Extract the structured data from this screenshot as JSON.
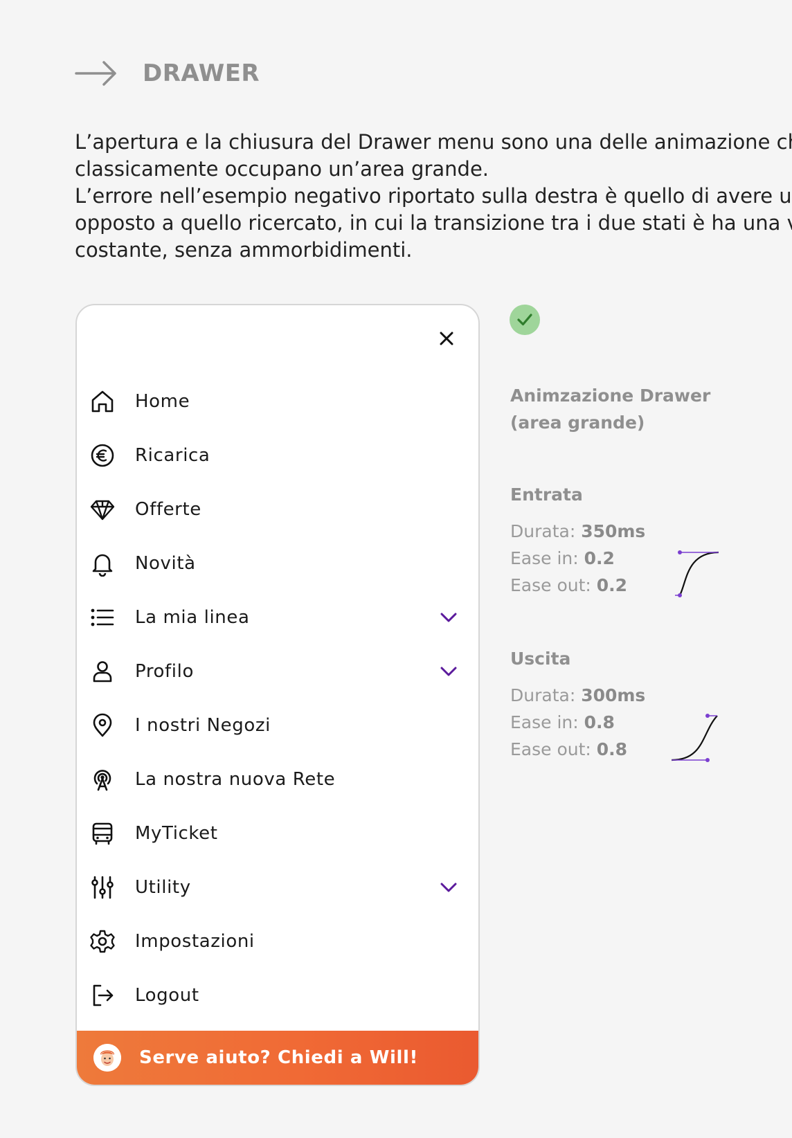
{
  "header": {
    "title": "DRAWER",
    "arrow_icon": "arrow-right-icon"
  },
  "intro": {
    "lines": [
      "L’apertura e la chiusura del Drawer menu sono una delle animazione ch",
      "classicamente occupano un’area grande.",
      "L’errore nell’esempio negativo riportato sulla destra è quello di avere un",
      "opposto a quello ricercato, in cui la transizione tra i due stati è ha una ve",
      "costante, senza ammorbidimenti."
    ]
  },
  "drawer": {
    "close_icon": "close-icon",
    "items": [
      {
        "label": "Home",
        "icon": "home-icon",
        "expandable": false
      },
      {
        "label": "Ricarica",
        "icon": "euro-icon",
        "expandable": false
      },
      {
        "label": "Offerte",
        "icon": "diamond-icon",
        "expandable": false
      },
      {
        "label": "Novità",
        "icon": "bell-icon",
        "expandable": false
      },
      {
        "label": "La mia linea",
        "icon": "list-icon",
        "expandable": true
      },
      {
        "label": "Profilo",
        "icon": "user-icon",
        "expandable": true
      },
      {
        "label": "I nostri Negozi",
        "icon": "location-pin-icon",
        "expandable": false
      },
      {
        "label": "La nostra nuova Rete",
        "icon": "antenna-icon",
        "expandable": false
      },
      {
        "label": "MyTicket",
        "icon": "bus-icon",
        "expandable": false
      },
      {
        "label": "Utility",
        "icon": "sliders-icon",
        "expandable": true
      },
      {
        "label": "Impostazioni",
        "icon": "gear-icon",
        "expandable": false
      },
      {
        "label": "Logout",
        "icon": "logout-icon",
        "expandable": false
      }
    ],
    "help": {
      "label": "Serve aiuto? Chiedi a Will!",
      "avatar_icon": "will-avatar-icon"
    },
    "accent_color": "#5b1a9c",
    "help_color": "#ee6a35"
  },
  "panel": {
    "status_icon": "check-icon",
    "status_color": "#9fd59a",
    "title_line1": "Animzazione Drawer",
    "title_line2": "(area grande)",
    "entrata": {
      "title": "Entrata",
      "durata_label": "Durata: ",
      "durata_value": "350ms",
      "ease_in_label": "Ease in: ",
      "ease_in_value": "0.2",
      "ease_out_label": "Ease out: ",
      "ease_out_value": "0.2"
    },
    "uscita": {
      "title": "Uscita",
      "durata_label": "Durata: ",
      "durata_value": "300ms",
      "ease_in_label": "Ease in: ",
      "ease_in_value": "0.8",
      "ease_out_label": "Ease out: ",
      "ease_out_value": "0.8"
    }
  }
}
